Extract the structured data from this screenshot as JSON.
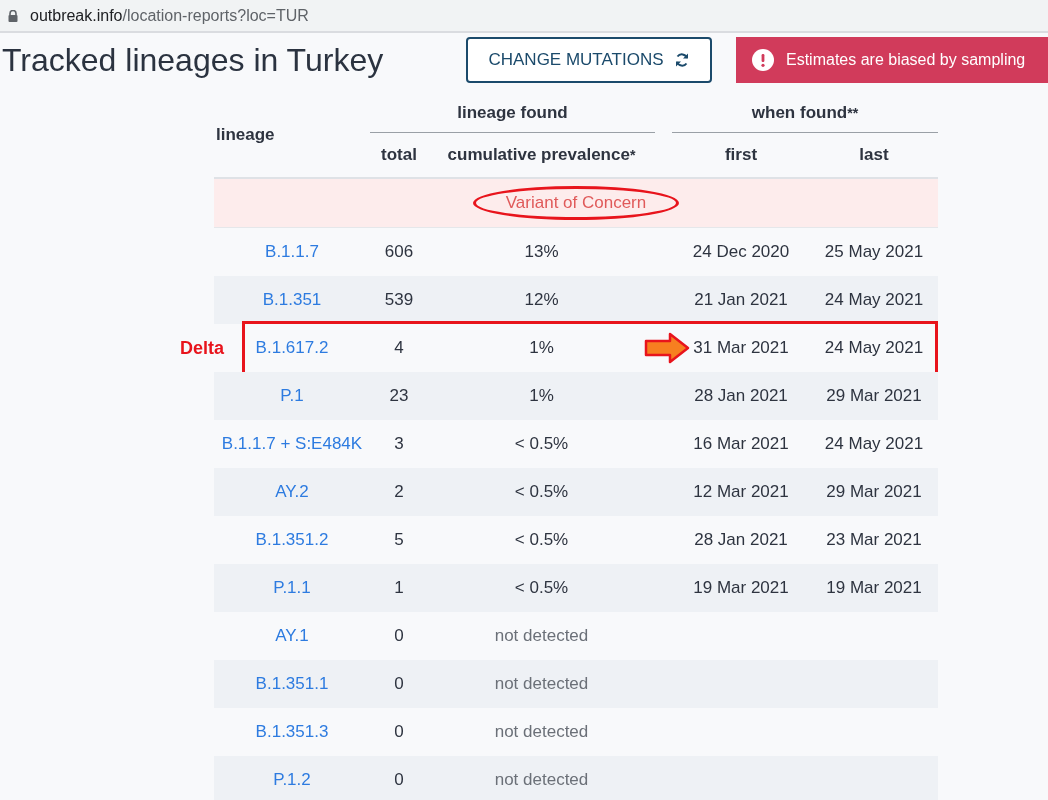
{
  "address_bar": {
    "domain": "outbreak.info",
    "path": "/location-reports?loc=TUR"
  },
  "title": "Tracked lineages in Turkey",
  "change_button": {
    "label": "CHANGE MUTATIONS"
  },
  "warning": {
    "text": "Estimates are biased by sampling"
  },
  "table": {
    "header": {
      "lineage": "lineage",
      "found_group": "lineage found",
      "total": "total",
      "prevalence": "cumulative prevalence",
      "prevalence_mark": "*",
      "when_group": "when found",
      "when_mark": "**",
      "first": "first",
      "last": "last"
    },
    "section": {
      "label": "Variant of Concern",
      "circled": true
    },
    "rows": [
      {
        "lineage": "B.1.1.7",
        "total": "606",
        "prevalence": "13%",
        "first": "24 Dec 2020",
        "last": "25 May 2021"
      },
      {
        "lineage": "B.1.351",
        "total": "539",
        "prevalence": "12%",
        "first": "21 Jan 2021",
        "last": "24 May 2021"
      },
      {
        "lineage": "B.1.617.2",
        "total": "4",
        "prevalence": "1%",
        "first": "31 Mar 2021",
        "last": "24 May 2021",
        "highlighted": true,
        "arrow": true,
        "note": "Delta"
      },
      {
        "lineage": "P.1",
        "total": "23",
        "prevalence": "1%",
        "first": "28 Jan 2021",
        "last": "29 Mar 2021"
      },
      {
        "lineage": "B.1.1.7 + S:E484K",
        "total": "3",
        "prevalence": "< 0.5%",
        "first": "16 Mar 2021",
        "last": "24 May 2021"
      },
      {
        "lineage": "AY.2",
        "total": "2",
        "prevalence": "< 0.5%",
        "first": "12 Mar 2021",
        "last": "29 Mar 2021"
      },
      {
        "lineage": "B.1.351.2",
        "total": "5",
        "prevalence": "< 0.5%",
        "first": "28 Jan 2021",
        "last": "23 Mar 2021"
      },
      {
        "lineage": "P.1.1",
        "total": "1",
        "prevalence": "< 0.5%",
        "first": "19 Mar 2021",
        "last": "19 Mar 2021"
      },
      {
        "lineage": "AY.1",
        "total": "0",
        "prevalence": "not detected"
      },
      {
        "lineage": "B.1.351.1",
        "total": "0",
        "prevalence": "not detected"
      },
      {
        "lineage": "B.1.351.3",
        "total": "0",
        "prevalence": "not detected"
      },
      {
        "lineage": "P.1.2",
        "total": "0",
        "prevalence": "not detected"
      }
    ]
  }
}
